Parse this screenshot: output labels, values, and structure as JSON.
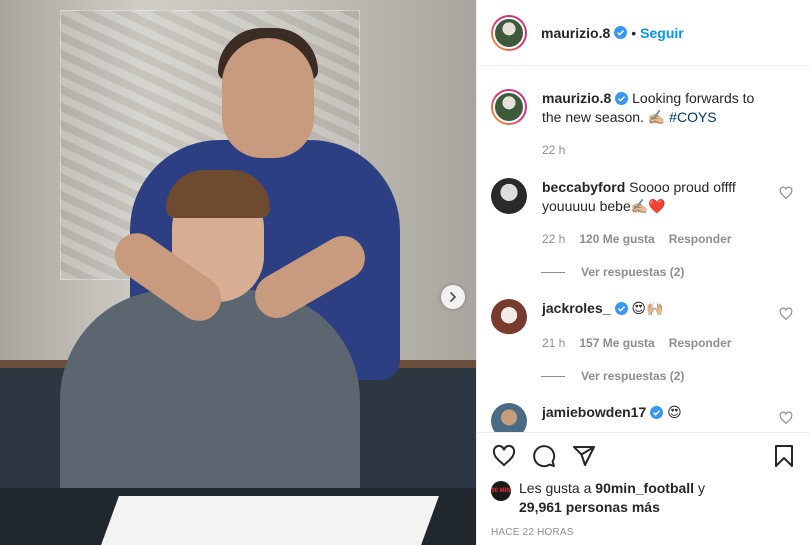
{
  "post": {
    "author": "maurizio.8",
    "follow_label": "Seguir",
    "caption_text": "Looking forwards to the new season. ✍🏼",
    "caption_hashtag": "#COYS",
    "caption_time": "22 h"
  },
  "comments": [
    {
      "username": "beccabyford",
      "text": "Soooo proud offff youuuuu bebe✍🏼❤️",
      "time": "22 h",
      "likes": "120 Me gusta",
      "reply_label": "Responder",
      "view_replies": "Ver respuestas (2)"
    },
    {
      "username": "jackroles_",
      "text": "😍🙌🏼",
      "time": "21 h",
      "likes": "157 Me gusta",
      "reply_label": "Responder",
      "view_replies": "Ver respuestas (2)"
    },
    {
      "username": "jamiebowden17",
      "text": "😍"
    }
  ],
  "likes_summary": {
    "prefix": "Les gusta a ",
    "user": "90min_football",
    "middle": " y",
    "count": "29,961 personas más",
    "avatar_text": "90 MIN"
  },
  "posted_ago": "HACE 22 HORAS",
  "colors": {
    "accent": "#0095f6",
    "verified": "#3897f0",
    "secondary_text": "#8e8e8e"
  },
  "icons": [
    "chevron-right-icon",
    "verified-icon",
    "heart-icon",
    "comment-icon",
    "share-icon",
    "bookmark-icon"
  ]
}
